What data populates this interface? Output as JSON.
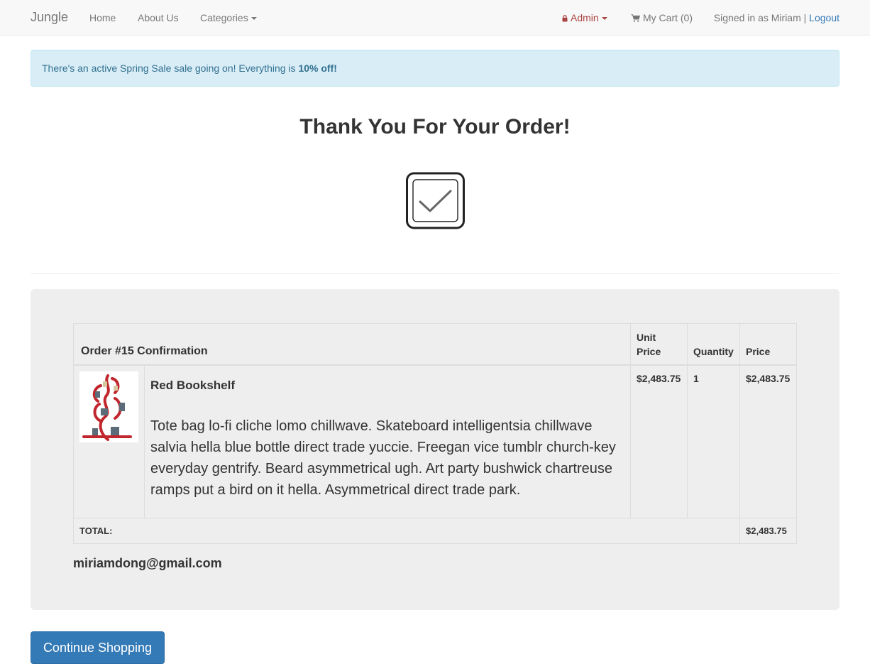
{
  "navbar": {
    "brand": "Jungle",
    "home": "Home",
    "about": "About Us",
    "categories": "Categories",
    "admin": "Admin",
    "cart": "My Cart (0)",
    "signed_in": "Signed in as Miriam",
    "separator": "|",
    "logout": "Logout"
  },
  "alert": {
    "text": "There's an active Spring Sale sale going on! Everything is ",
    "bold": "10% off!"
  },
  "page_title": "Thank You For Your Order!",
  "order": {
    "heading": "Order #15 Confirmation",
    "columns": {
      "unit_price": "Unit Price",
      "quantity": "Quantity",
      "price": "Price"
    },
    "items": [
      {
        "name": "Red Bookshelf",
        "description": "Tote bag lo-fi cliche lomo chillwave. Skateboard intelligentsia chillwave salvia hella blue bottle direct trade yuccie. Freegan vice tumblr church-key everyday gentrify. Beard asymmetrical ugh. Art party bushwick chartreuse ramps put a bird on it hella. Asymmetrical direct trade park.",
        "unit_price": "$2,483.75",
        "quantity": "1",
        "price": "$2,483.75"
      }
    ],
    "total_label": "TOTAL:",
    "total": "$2,483.75",
    "email": "miriamdong@gmail.com"
  },
  "buttons": {
    "continue": "Continue Shopping"
  },
  "colors": {
    "primary": "#337ab7",
    "alert_bg": "#d9edf7",
    "admin": "#a94442",
    "panel_bg": "#eeeeee"
  },
  "icons": {
    "admin": "lock-icon",
    "cart": "shopping-cart-icon",
    "confirmation": "checkbox-check-icon"
  }
}
